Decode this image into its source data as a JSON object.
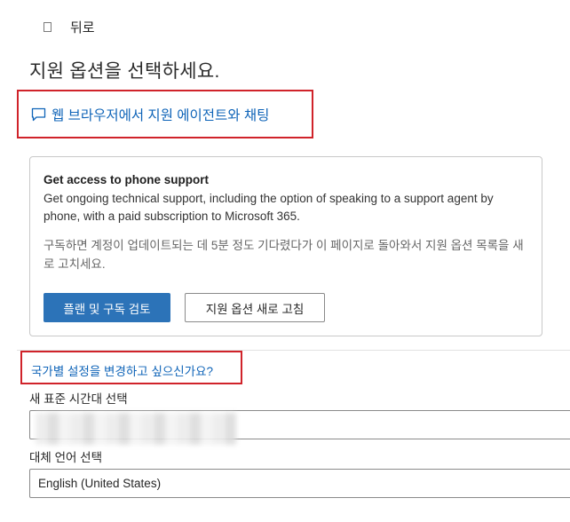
{
  "nav": {
    "back_label": "뒤로"
  },
  "page": {
    "title": "지원 옵션을 선택하세요."
  },
  "chat": {
    "link_label": "웹 브라우저에서 지원 에이전트와 채팅"
  },
  "phone_support": {
    "title": "Get access to phone support",
    "description": "Get ongoing technical support, including the option of speaking to a support agent by phone, with a paid subscription to Microsoft 365.",
    "note": "구독하면 계정이 업데이트되는 데 5분 정도 기다렸다가 이 페이지로 돌아와서 지원 옵션 목록을 새로 고치세요.",
    "primary_button": "플랜 및 구독 검토",
    "secondary_button": "지원 옵션 새로 고침"
  },
  "region": {
    "link_label": "국가별 설정을 변경하고 싶으신가요?"
  },
  "timezone": {
    "label": "새 표준 시간대 선택"
  },
  "language": {
    "label": "대체 언어 선택",
    "value": "English (United States)"
  },
  "colors": {
    "link": "#0f64b8",
    "primary_button": "#2c73b8",
    "highlight_border": "#d0232a"
  }
}
